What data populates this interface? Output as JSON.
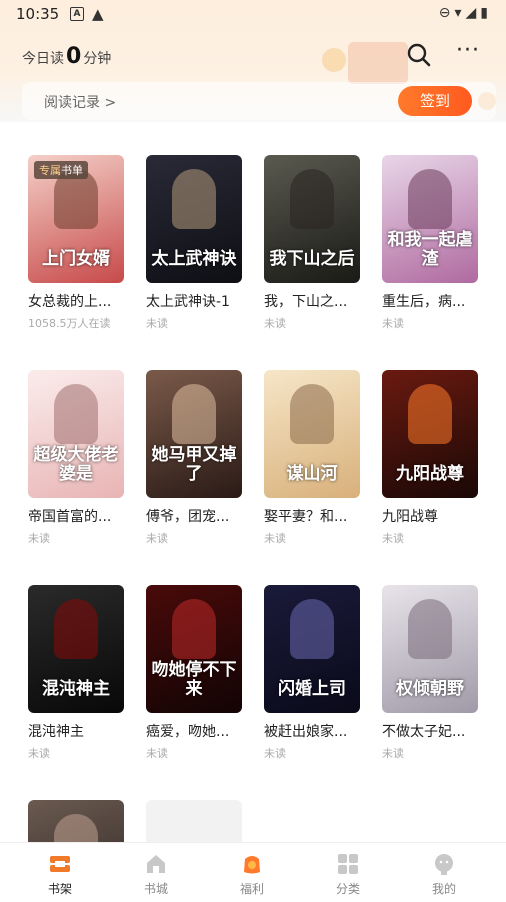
{
  "status_bar": {
    "time": "10:35",
    "icons": [
      "a-icon",
      "warning-icon",
      "dnd-icon",
      "wifi-icon",
      "signal-icon",
      "battery-icon"
    ]
  },
  "header": {
    "reading_prefix": "今日读",
    "reading_minutes": "0",
    "reading_suffix": "分钟",
    "history_label": "阅读记录 >",
    "checkin_label": "签到"
  },
  "books": [
    {
      "title": "女总裁的上...",
      "status": "1058.5万人在读",
      "cover_text": "上门女婿",
      "badge_prefix": "专属",
      "badge_main": "书单",
      "c1": "#f4d0c8",
      "c2": "#c74a4a",
      "fig": "#6b3a2a"
    },
    {
      "title": "太上武神诀-1",
      "status": "未读",
      "cover_text": "太上武神诀",
      "c1": "#2a2a38",
      "c2": "#0e0e14",
      "fig": "#b49a7a"
    },
    {
      "title": "我，下山之...",
      "status": "未读",
      "cover_text": "我下山之后",
      "c1": "#5a5a50",
      "c2": "#1a1a16",
      "fig": "#2a2420"
    },
    {
      "title": "重生后，病...",
      "status": "未读",
      "cover_text": "和我一起虐渣",
      "c1": "#e8d6e8",
      "c2": "#b06aa0",
      "fig": "#6a3a5a"
    },
    {
      "title": "帝国首富的...",
      "status": "未读",
      "cover_text": "超级大佬老婆是",
      "c1": "#fbecec",
      "c2": "#e8b4b4",
      "fig": "#a07070"
    },
    {
      "title": "傅爷，团宠...",
      "status": "未读",
      "cover_text": "她马甲又掉了",
      "c1": "#7a5a4a",
      "c2": "#2a1a16",
      "fig": "#e0c0a0"
    },
    {
      "title": "娶平妻？和...",
      "status": "未读",
      "cover_text": "谋山河",
      "c1": "#f6e6c8",
      "c2": "#d8b07a",
      "fig": "#8a6a4a"
    },
    {
      "title": "九阳战尊",
      "status": "未读",
      "cover_text": "九阳战尊",
      "c1": "#6a1a10",
      "c2": "#1a0806",
      "fig": "#ff7a2a"
    },
    {
      "title": "混沌神主",
      "status": "未读",
      "cover_text": "混沌神主",
      "c1": "#2a2a2a",
      "c2": "#080808",
      "fig": "#8a0a0a"
    },
    {
      "title": "癌爱，吻她...",
      "status": "未读",
      "cover_text": "吻她停不下来",
      "c1": "#4a0a0a",
      "c2": "#120404",
      "fig": "#c02a2a"
    },
    {
      "title": "被赶出娘家...",
      "status": "未读",
      "cover_text": "闪婚上司",
      "c1": "#1a1a3a",
      "c2": "#0a0a1a",
      "fig": "#6a6ab0"
    },
    {
      "title": "不做太子妃...",
      "status": "未读",
      "cover_text": "权倾朝野",
      "c1": "#e8e4ea",
      "c2": "#a09aa8",
      "fig": "#7a6a7a"
    },
    {
      "title": "",
      "status": "",
      "cover_text": "",
      "c1": "#6a5a50",
      "c2": "#2a2020",
      "fig": "#c0a090"
    },
    {
      "title": "",
      "status": "",
      "cover_text": "",
      "c1": "#f2f2f2",
      "c2": "#f2f2f2",
      "fig": "#f2f2f2"
    }
  ],
  "tabs": [
    {
      "label": "书架",
      "icon": "bookshelf-icon",
      "active": true
    },
    {
      "label": "书城",
      "icon": "bookstore-icon",
      "active": false
    },
    {
      "label": "福利",
      "icon": "welfare-icon",
      "active": false
    },
    {
      "label": "分类",
      "icon": "category-icon",
      "active": false
    },
    {
      "label": "我的",
      "icon": "profile-icon",
      "active": false
    }
  ],
  "colors": {
    "accent": "#ff6a24",
    "tab_active": "#f07a2a",
    "tab_inactive": "#c8c8c8"
  }
}
